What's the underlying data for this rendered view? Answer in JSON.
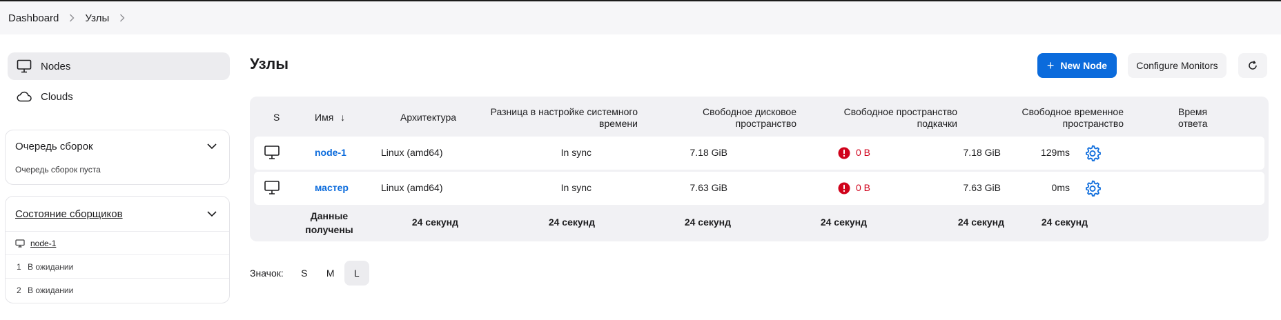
{
  "breadcrumb": {
    "items": [
      "Dashboard",
      "Узлы"
    ]
  },
  "sidebar": {
    "items": [
      {
        "label": "Nodes",
        "icon": "computer-icon",
        "active": true
      },
      {
        "label": "Clouds",
        "icon": "cloud-icon",
        "active": false
      }
    ],
    "build_queue": {
      "title": "Очередь сборок",
      "empty_text": "Очередь сборок пуста"
    },
    "executors": {
      "title": "Состояние сборщиков",
      "node": "node-1",
      "rows": [
        {
          "num": "1",
          "status": "В ожидании"
        },
        {
          "num": "2",
          "status": "В ожидании"
        }
      ]
    }
  },
  "header": {
    "title": "Узлы",
    "new_node_label": "New Node",
    "configure_monitors_label": "Configure Monitors",
    "refresh_icon": "refresh-icon"
  },
  "table": {
    "headers": {
      "s": "S",
      "name": "Имя",
      "sort_arrow": "↓",
      "arch": "Архитектура",
      "clock_line1": "Разница в настройке системного",
      "clock_line2": "времени",
      "disk_line1": "Свободное дисковое",
      "disk_line2": "пространство",
      "swap_line1": "Свободное пространство",
      "swap_line2": "подкачки",
      "temp_line1": "Свободное временное",
      "temp_line2": "пространство",
      "resp_line1": "Время",
      "resp_line2": "ответа"
    },
    "rows": [
      {
        "name": "node-1",
        "arch": "Linux (amd64)",
        "clock": "In sync",
        "disk": "7.18 GiB",
        "swap": "0 B",
        "temp": "7.18 GiB",
        "response": "129ms"
      },
      {
        "name": "мастер",
        "arch": "Linux (amd64)",
        "clock": "In sync",
        "disk": "7.63 GiB",
        "swap": "0 B",
        "temp": "7.63 GiB",
        "response": "0ms"
      }
    ],
    "footer": {
      "label_line1": "Данные",
      "label_line2": "получены",
      "arch": "24 секунд",
      "clock": "24 секунд",
      "disk": "24 секунд",
      "swap": "24 секунд",
      "temp": "24 секунд",
      "response": "24 секунд"
    }
  },
  "icon_size": {
    "label": "Значок:",
    "options": [
      "S",
      "M",
      "L"
    ],
    "selected": "L"
  },
  "colors": {
    "accent": "#0b6bdc",
    "danger": "#d0021b",
    "gear": "#0b6bdc"
  }
}
